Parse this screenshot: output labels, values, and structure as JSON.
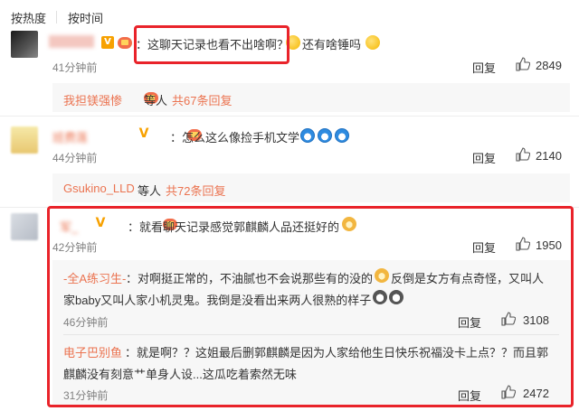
{
  "sort": {
    "hot": "按热度",
    "time": "按时间"
  },
  "comments": [
    {
      "user": "",
      "text": "：这聊天记录也看不出啥啊？",
      "text_tail": "还有啥锤吗",
      "time": "41分钟前",
      "reply_label": "回复",
      "likes": "2849",
      "more": {
        "name": "我担镁强惨",
        "suffix": "等人",
        "count": "共67条回复"
      }
    },
    {
      "user": "班费莲",
      "text": "：怎么这么像捡手机文学",
      "time": "44分钟前",
      "reply_label": "回复",
      "likes": "2140",
      "more": {
        "name": "Gsukino_LLD",
        "suffix": "等人",
        "count": "共72条回复"
      }
    },
    {
      "user": "军_",
      "text": "：就看聊天记录感觉郭麒麟人品还挺好的",
      "time": "42分钟前",
      "reply_label": "回复",
      "likes": "1950",
      "replies": [
        {
          "user": "-全A练习生-",
          "line1": "：对啊挺正常的，不油腻也不会说那些有的没的",
          "line1_tail": "反倒是女方有点奇怪，又叫人",
          "line2": "家baby又叫人家小机灵鬼。我倒是没看出来两人很熟的样子",
          "time": "46分钟前",
          "reply_label": "回复",
          "likes": "3108"
        },
        {
          "user": "电子巴别鱼",
          "line1": "：就是啊？？这姐最后删郭麒麟是因为人家给他生日快乐祝福没卡上点？？而且郭",
          "line2": "麒麟没有刻意艹单身人设...这瓜吃着索然无味",
          "time": "31分钟前",
          "reply_label": "回复",
          "likes": "2472"
        }
      ]
    }
  ],
  "colors": {
    "accent": "#eb7350",
    "highlight": "#e9232a",
    "badge_v": "#f7a100"
  },
  "icons": [
    "thumb-up-icon",
    "verified-v-icon",
    "member-crown-icon",
    "emoji-icon"
  ]
}
